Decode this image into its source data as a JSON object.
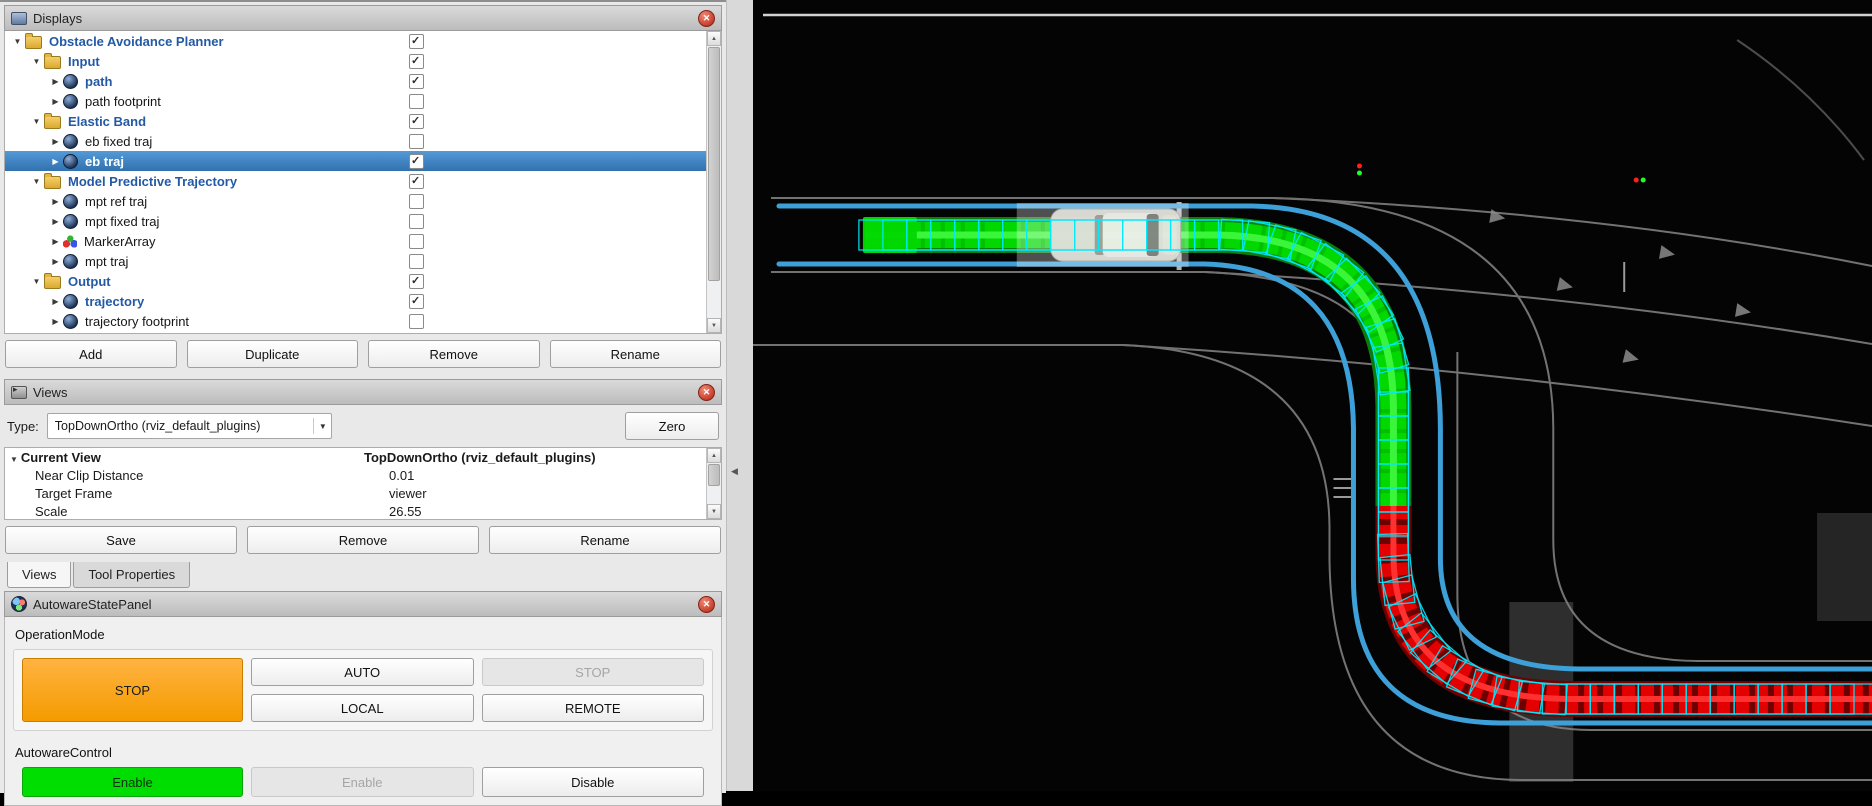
{
  "displays": {
    "title": "Displays",
    "tree": [
      {
        "label": "Obstacle Avoidance Planner",
        "level": 0,
        "icon": "folder",
        "twisty": "down",
        "checked": true,
        "selected": false
      },
      {
        "label": "Input",
        "level": 1,
        "icon": "folder",
        "twisty": "down",
        "checked": true,
        "selected": false
      },
      {
        "label": "path",
        "level": 2,
        "icon": "display",
        "twisty": "right",
        "checked": true,
        "selected": false
      },
      {
        "label": "path footprint",
        "level": 2,
        "icon": "display",
        "twisty": "right",
        "checked": false,
        "selected": false
      },
      {
        "label": "Elastic Band",
        "level": 1,
        "icon": "folder",
        "twisty": "down",
        "checked": true,
        "selected": false
      },
      {
        "label": "eb fixed traj",
        "level": 2,
        "icon": "display",
        "twisty": "right",
        "checked": false,
        "selected": false
      },
      {
        "label": "eb traj",
        "level": 2,
        "icon": "display",
        "twisty": "right",
        "checked": true,
        "selected": true
      },
      {
        "label": "Model Predictive Trajectory",
        "level": 1,
        "icon": "folder",
        "twisty": "down",
        "checked": true,
        "selected": false
      },
      {
        "label": "mpt ref traj",
        "level": 2,
        "icon": "display",
        "twisty": "right",
        "checked": false,
        "selected": false
      },
      {
        "label": "mpt fixed traj",
        "level": 2,
        "icon": "display",
        "twisty": "right",
        "checked": false,
        "selected": false
      },
      {
        "label": "MarkerArray",
        "level": 2,
        "icon": "marker-array",
        "twisty": "right",
        "checked": false,
        "selected": false
      },
      {
        "label": "mpt traj",
        "level": 2,
        "icon": "display",
        "twisty": "right",
        "checked": false,
        "selected": false
      },
      {
        "label": "Output",
        "level": 1,
        "icon": "folder",
        "twisty": "down",
        "checked": true,
        "selected": false
      },
      {
        "label": "trajectory",
        "level": 2,
        "icon": "display",
        "twisty": "right",
        "checked": true,
        "selected": false
      },
      {
        "label": "trajectory footprint",
        "level": 2,
        "icon": "display",
        "twisty": "right",
        "checked": false,
        "selected": false
      }
    ],
    "buttons": {
      "add": "Add",
      "duplicate": "Duplicate",
      "remove": "Remove",
      "rename": "Rename"
    }
  },
  "views": {
    "title": "Views",
    "type_label": "Type:",
    "type_value": "TopDownOrtho (rviz_default_plugins)",
    "zero": "Zero",
    "rows": [
      {
        "name": "Current View",
        "value": "TopDownOrtho (rviz_default_plugins)"
      },
      {
        "name": "Near Clip Distance",
        "value": "0.01"
      },
      {
        "name": "Target Frame",
        "value": "viewer"
      },
      {
        "name": "Scale",
        "value": "26.55"
      }
    ],
    "buttons": {
      "save": "Save",
      "remove": "Remove",
      "rename": "Rename"
    },
    "tabs": [
      {
        "label": "Views",
        "active": true
      },
      {
        "label": "Tool Properties",
        "active": false
      }
    ]
  },
  "autoware": {
    "title": "AutowareStatePanel",
    "operation_mode_label": "OperationMode",
    "buttons": {
      "stop_active": "STOP",
      "auto": "AUTO",
      "stop_disabled": "STOP",
      "local": "LOCAL",
      "remote": "REMOTE"
    },
    "autoware_control_label": "AutowareControl",
    "control_buttons": {
      "enable_active": "Enable",
      "enable_disabled": "Enable",
      "disable": "Disable"
    }
  },
  "viz": {
    "colors": {
      "background": "#000000",
      "path_green": "#00c800",
      "path_red": "#e00000",
      "trajectory_cyan": "#00eaff",
      "drivable_bound_blue": "#3da0d8",
      "road_gray": "#808080",
      "selection_blue": "#3f81c1",
      "stop_orange": "#f59b00",
      "enable_green": "#00dd00"
    }
  }
}
